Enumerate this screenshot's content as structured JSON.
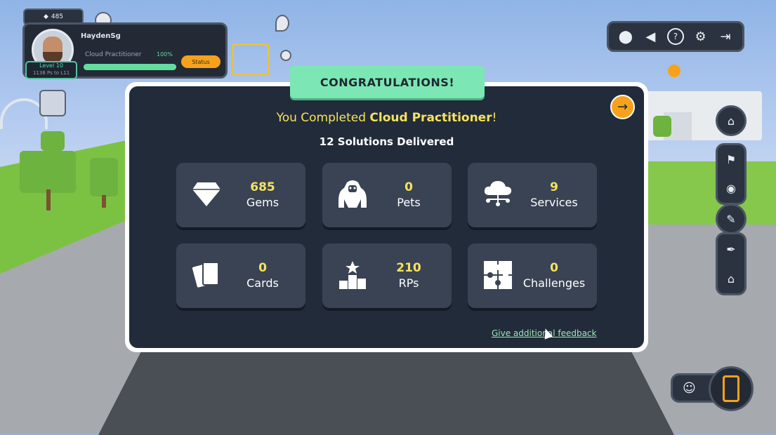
{
  "hud": {
    "mini_badge": "485",
    "player_name": "HaydenSg",
    "player_class": "Cloud Practitioner",
    "player_progress_text": "100%",
    "player_progress": 1.0,
    "level_label": "Level 10",
    "level_sub": "1138 Ps to L11",
    "action_button": "Status"
  },
  "modal": {
    "banner": "CONGRATULATIONS!",
    "completed_prefix": "You Completed ",
    "completed_name": "Cloud Practitioner",
    "completed_suffix": "!",
    "delivered": "12 Solutions Delivered",
    "stats": [
      {
        "icon": "gem-icon",
        "value": "685",
        "label": "Gems"
      },
      {
        "icon": "gorilla-icon",
        "value": "0",
        "label": "Pets"
      },
      {
        "icon": "cloud-network-icon",
        "value": "9",
        "label": "Services"
      },
      {
        "icon": "cards-icon",
        "value": "0",
        "label": "Cards"
      },
      {
        "icon": "podium-icon",
        "value": "210",
        "label": "RPs"
      },
      {
        "icon": "puzzle-icon",
        "value": "0",
        "label": "Challenges"
      }
    ],
    "feedback_link": "Give additional feedback"
  },
  "colors": {
    "banner": "#7ce7b4",
    "panel": "#222b3a",
    "tile": "#3a4354",
    "value": "#f6e35a",
    "accent": "#f7a21d"
  }
}
